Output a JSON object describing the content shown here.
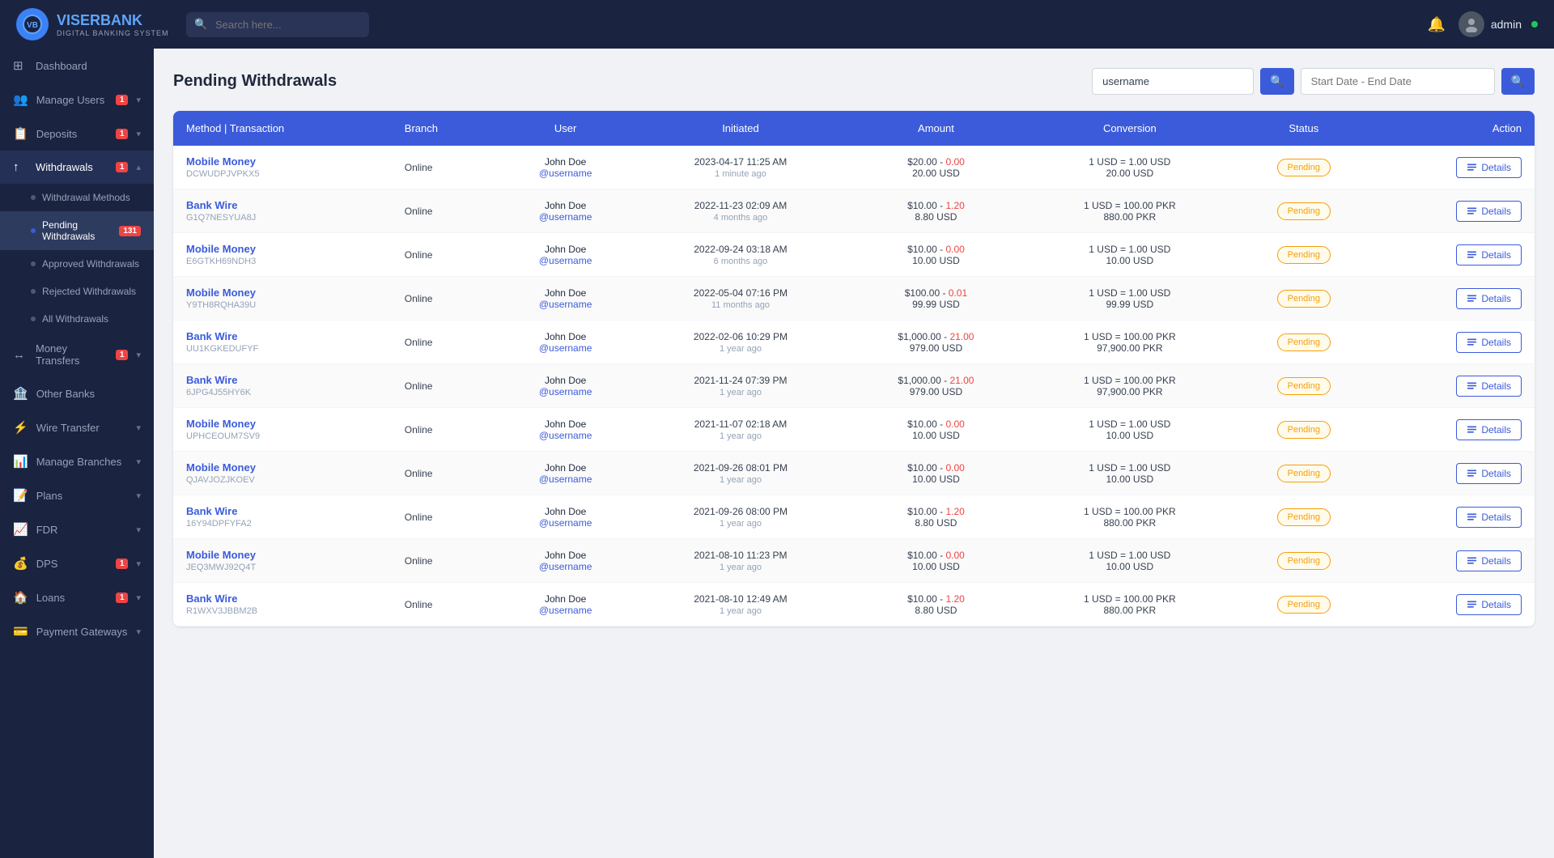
{
  "topnav": {
    "logo_short": "VB",
    "logo_bank": "VISERBANK",
    "logo_sub": "DIGITAL BANKING SYSTEM",
    "search_placeholder": "Search here...",
    "admin_name": "admin",
    "bell_icon": "🔔",
    "admin_avatar_icon": "👤"
  },
  "sidebar": {
    "items": [
      {
        "id": "dashboard",
        "icon": "⊞",
        "label": "Dashboard",
        "badge": null,
        "chevron": false,
        "active": false
      },
      {
        "id": "manage-users",
        "icon": "👥",
        "label": "Manage Users",
        "badge": "1",
        "chevron": true,
        "active": false
      },
      {
        "id": "deposits",
        "icon": "📋",
        "label": "Deposits",
        "badge": "1",
        "chevron": true,
        "active": false
      },
      {
        "id": "withdrawals",
        "icon": "↑",
        "label": "Withdrawals",
        "badge": "1",
        "chevron": true,
        "active": true
      }
    ],
    "withdrawal_sub": [
      {
        "id": "withdrawal-methods",
        "label": "Withdrawal Methods",
        "active": false,
        "badge": null
      },
      {
        "id": "pending-withdrawals",
        "label": "Pending Withdrawals",
        "active": true,
        "badge": "131"
      },
      {
        "id": "approved-withdrawals",
        "label": "Approved Withdrawals",
        "active": false,
        "badge": null
      },
      {
        "id": "rejected-withdrawals",
        "label": "Rejected Withdrawals",
        "active": false,
        "badge": null
      },
      {
        "id": "all-withdrawals",
        "label": "All Withdrawals",
        "active": false,
        "badge": null
      }
    ],
    "other_items": [
      {
        "id": "money-transfers",
        "icon": "↔",
        "label": "Money Transfers",
        "badge": "1",
        "chevron": true
      },
      {
        "id": "other-banks",
        "icon": "🏦",
        "label": "Other Banks",
        "badge": null,
        "chevron": false
      },
      {
        "id": "wire-transfer",
        "icon": "⚡",
        "label": "Wire Transfer",
        "badge": null,
        "chevron": true
      },
      {
        "id": "manage-branches",
        "icon": "📊",
        "label": "Manage Branches",
        "badge": null,
        "chevron": true
      },
      {
        "id": "plans",
        "icon": "📝",
        "label": "Plans",
        "badge": null,
        "chevron": true
      },
      {
        "id": "fdr",
        "icon": "📈",
        "label": "FDR",
        "badge": null,
        "chevron": true
      },
      {
        "id": "dps",
        "icon": "💰",
        "label": "DPS",
        "badge": "1",
        "chevron": true
      },
      {
        "id": "loans",
        "icon": "🏠",
        "label": "Loans",
        "badge": "1",
        "chevron": true
      },
      {
        "id": "payment-gateways",
        "icon": "💳",
        "label": "Payment Gateways",
        "badge": null,
        "chevron": true
      }
    ]
  },
  "page": {
    "title": "Pending Withdrawals",
    "username_filter": "username",
    "username_placeholder": "username",
    "date_placeholder": "Start Date - End Date"
  },
  "table": {
    "columns": [
      "Method | Transaction",
      "Branch",
      "User",
      "Initiated",
      "Amount",
      "Conversion",
      "Status",
      "Action"
    ],
    "status_label": "Pending",
    "details_label": "Details",
    "rows": [
      {
        "method": "Mobile Money",
        "tx_id": "DCWUDPJVPKX5",
        "branch": "Online",
        "user_name": "John Doe",
        "user_link": "@username",
        "date": "2023-04-17 11:25 AM",
        "time_ago": "1 minute ago",
        "amount_main": "$20.00",
        "fee": "0.00",
        "net": "20.00 USD",
        "rate": "1 USD = 1.00 USD",
        "converted": "20.00 USD",
        "status": "Pending"
      },
      {
        "method": "Bank Wire",
        "tx_id": "G1Q7NESYUA8J",
        "branch": "Online",
        "user_name": "John Doe",
        "user_link": "@username",
        "date": "2022-11-23 02:09 AM",
        "time_ago": "4 months ago",
        "amount_main": "$10.00",
        "fee": "1.20",
        "net": "8.80 USD",
        "rate": "1 USD = 100.00 PKR",
        "converted": "880.00 PKR",
        "status": "Pending"
      },
      {
        "method": "Mobile Money",
        "tx_id": "E6GTKH69NDH3",
        "branch": "Online",
        "user_name": "John Doe",
        "user_link": "@username",
        "date": "2022-09-24 03:18 AM",
        "time_ago": "6 months ago",
        "amount_main": "$10.00",
        "fee": "0.00",
        "net": "10.00 USD",
        "rate": "1 USD = 1.00 USD",
        "converted": "10.00 USD",
        "status": "Pending"
      },
      {
        "method": "Mobile Money",
        "tx_id": "Y9TH8RQHA39U",
        "branch": "Online",
        "user_name": "John Doe",
        "user_link": "@username",
        "date": "2022-05-04 07:16 PM",
        "time_ago": "11 months ago",
        "amount_main": "$100.00",
        "fee": "0.01",
        "net": "99.99 USD",
        "rate": "1 USD = 1.00 USD",
        "converted": "99.99 USD",
        "status": "Pending"
      },
      {
        "method": "Bank Wire",
        "tx_id": "UU1KGKEDUFYF",
        "branch": "Online",
        "user_name": "John Doe",
        "user_link": "@username",
        "date": "2022-02-06 10:29 PM",
        "time_ago": "1 year ago",
        "amount_main": "$1,000.00",
        "fee": "21.00",
        "net": "979.00 USD",
        "rate": "1 USD = 100.00 PKR",
        "converted": "97,900.00 PKR",
        "status": "Pending"
      },
      {
        "method": "Bank Wire",
        "tx_id": "6JPG4J55HY6K",
        "branch": "Online",
        "user_name": "John Doe",
        "user_link": "@username",
        "date": "2021-11-24 07:39 PM",
        "time_ago": "1 year ago",
        "amount_main": "$1,000.00",
        "fee": "21.00",
        "net": "979.00 USD",
        "rate": "1 USD = 100.00 PKR",
        "converted": "97,900.00 PKR",
        "status": "Pending"
      },
      {
        "method": "Mobile Money",
        "tx_id": "UPHCEOUM7SV9",
        "branch": "Online",
        "user_name": "John Doe",
        "user_link": "@username",
        "date": "2021-11-07 02:18 AM",
        "time_ago": "1 year ago",
        "amount_main": "$10.00",
        "fee": "0.00",
        "net": "10.00 USD",
        "rate": "1 USD = 1.00 USD",
        "converted": "10.00 USD",
        "status": "Pending"
      },
      {
        "method": "Mobile Money",
        "tx_id": "QJAVJOZJKOEV",
        "branch": "Online",
        "user_name": "John Doe",
        "user_link": "@username",
        "date": "2021-09-26 08:01 PM",
        "time_ago": "1 year ago",
        "amount_main": "$10.00",
        "fee": "0.00",
        "net": "10.00 USD",
        "rate": "1 USD = 1.00 USD",
        "converted": "10.00 USD",
        "status": "Pending"
      },
      {
        "method": "Bank Wire",
        "tx_id": "16Y94DPFYFA2",
        "branch": "Online",
        "user_name": "John Doe",
        "user_link": "@username",
        "date": "2021-09-26 08:00 PM",
        "time_ago": "1 year ago",
        "amount_main": "$10.00",
        "fee": "1.20",
        "net": "8.80 USD",
        "rate": "1 USD = 100.00 PKR",
        "converted": "880.00 PKR",
        "status": "Pending"
      },
      {
        "method": "Mobile Money",
        "tx_id": "JEQ3MWJ92Q4T",
        "branch": "Online",
        "user_name": "John Doe",
        "user_link": "@username",
        "date": "2021-08-10 11:23 PM",
        "time_ago": "1 year ago",
        "amount_main": "$10.00",
        "fee": "0.00",
        "net": "10.00 USD",
        "rate": "1 USD = 1.00 USD",
        "converted": "10.00 USD",
        "status": "Pending"
      },
      {
        "method": "Bank Wire",
        "tx_id": "R1WXV3JBBM2B",
        "branch": "Online",
        "user_name": "John Doe",
        "user_link": "@username",
        "date": "2021-08-10 12:49 AM",
        "time_ago": "1 year ago",
        "amount_main": "$10.00",
        "fee": "1.20",
        "net": "8.80 USD",
        "rate": "1 USD = 100.00 PKR",
        "converted": "880.00 PKR",
        "status": "Pending"
      }
    ]
  }
}
